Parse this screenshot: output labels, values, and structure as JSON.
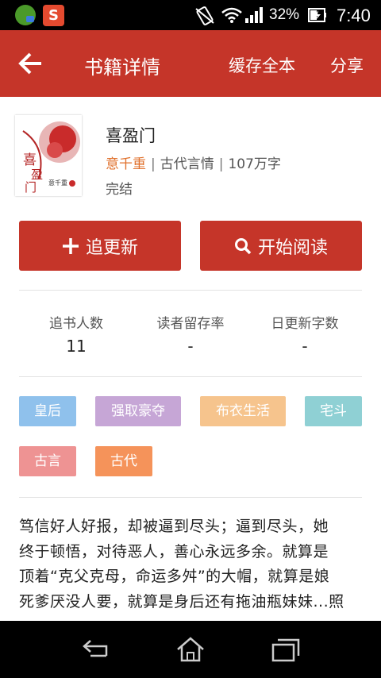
{
  "status_bar": {
    "battery_percent": "32%",
    "time": "7:40",
    "app2_letter": "S"
  },
  "header": {
    "title": "书籍详情",
    "cache_label": "缓存全本",
    "share_label": "分享"
  },
  "book": {
    "title": "喜盈门",
    "author": "意千重",
    "category": "古代言情",
    "word_count": "107万字",
    "status": "完结",
    "cover_title": "喜盈门",
    "cover_author": "意千重"
  },
  "actions": {
    "follow_label": "追更新",
    "read_label": "开始阅读"
  },
  "stats": [
    {
      "label": "追书人数",
      "value": "11"
    },
    {
      "label": "读者留存率",
      "value": "-"
    },
    {
      "label": "日更新字数",
      "value": "-"
    }
  ],
  "tags": [
    {
      "label": "皇后",
      "color": "#8fc1ec"
    },
    {
      "label": "强取豪夺",
      "color": "#c6a6d6"
    },
    {
      "label": "布衣生活",
      "color": "#f6c48d"
    },
    {
      "label": "宅斗",
      "color": "#8fd0d4"
    },
    {
      "label": "古言",
      "color": "#ee9393"
    },
    {
      "label": "古代",
      "color": "#f5935a"
    }
  ],
  "description_lines": [
    "笃信好人好报，却被逼到尽头；逼到尽头，她",
    "终于顿悟，对待恶人，善心永远多余。就算是",
    "顶着“克父克母，命运多舛”的大帽，就算是娘",
    "死爹厌没人要，就算是身后还有拖油瓶妹妹...照"
  ],
  "colors": {
    "accent": "#c53529",
    "author": "#e0712d"
  }
}
